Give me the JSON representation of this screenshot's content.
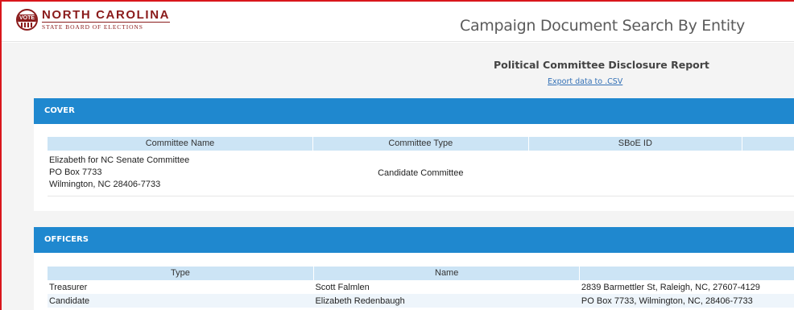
{
  "header": {
    "logo_line1": "NORTH CAROLINA",
    "logo_line2": "STATE BOARD OF ELECTIONS",
    "seal_text": "VOTE",
    "page_title": "Campaign Document Search By Entity"
  },
  "report": {
    "title": "Political Committee Disclosure Report",
    "export_link": "Export data to .CSV"
  },
  "cover": {
    "section_title": "COVER",
    "columns": [
      "Committee Name",
      "Committee Type",
      "SBoE ID",
      ""
    ],
    "committee_name_lines": [
      "Elizabeth for NC Senate Committee",
      "PO Box 7733",
      "Wilmington, NC 28406-7733"
    ],
    "committee_type": "Candidate Committee",
    "sboe_id": ""
  },
  "officers": {
    "section_title": "OFFICERS",
    "columns": [
      "Type",
      "Name",
      ""
    ],
    "rows": [
      {
        "type": "Treasurer",
        "name": "Scott Falmlen",
        "address": "2839 Barmettler St, Raleigh, NC, 27607-4129"
      },
      {
        "type": "Candidate",
        "name": "Elizabeth Redenbaugh",
        "address": "PO Box 7733, Wilmington, NC, 28406-7733"
      }
    ]
  },
  "colors": {
    "frame_border": "#d9161c",
    "logo": "#8a1b1b",
    "panel_header": "#1f88cf",
    "table_header": "#cce4f5",
    "link": "#3471b6"
  }
}
